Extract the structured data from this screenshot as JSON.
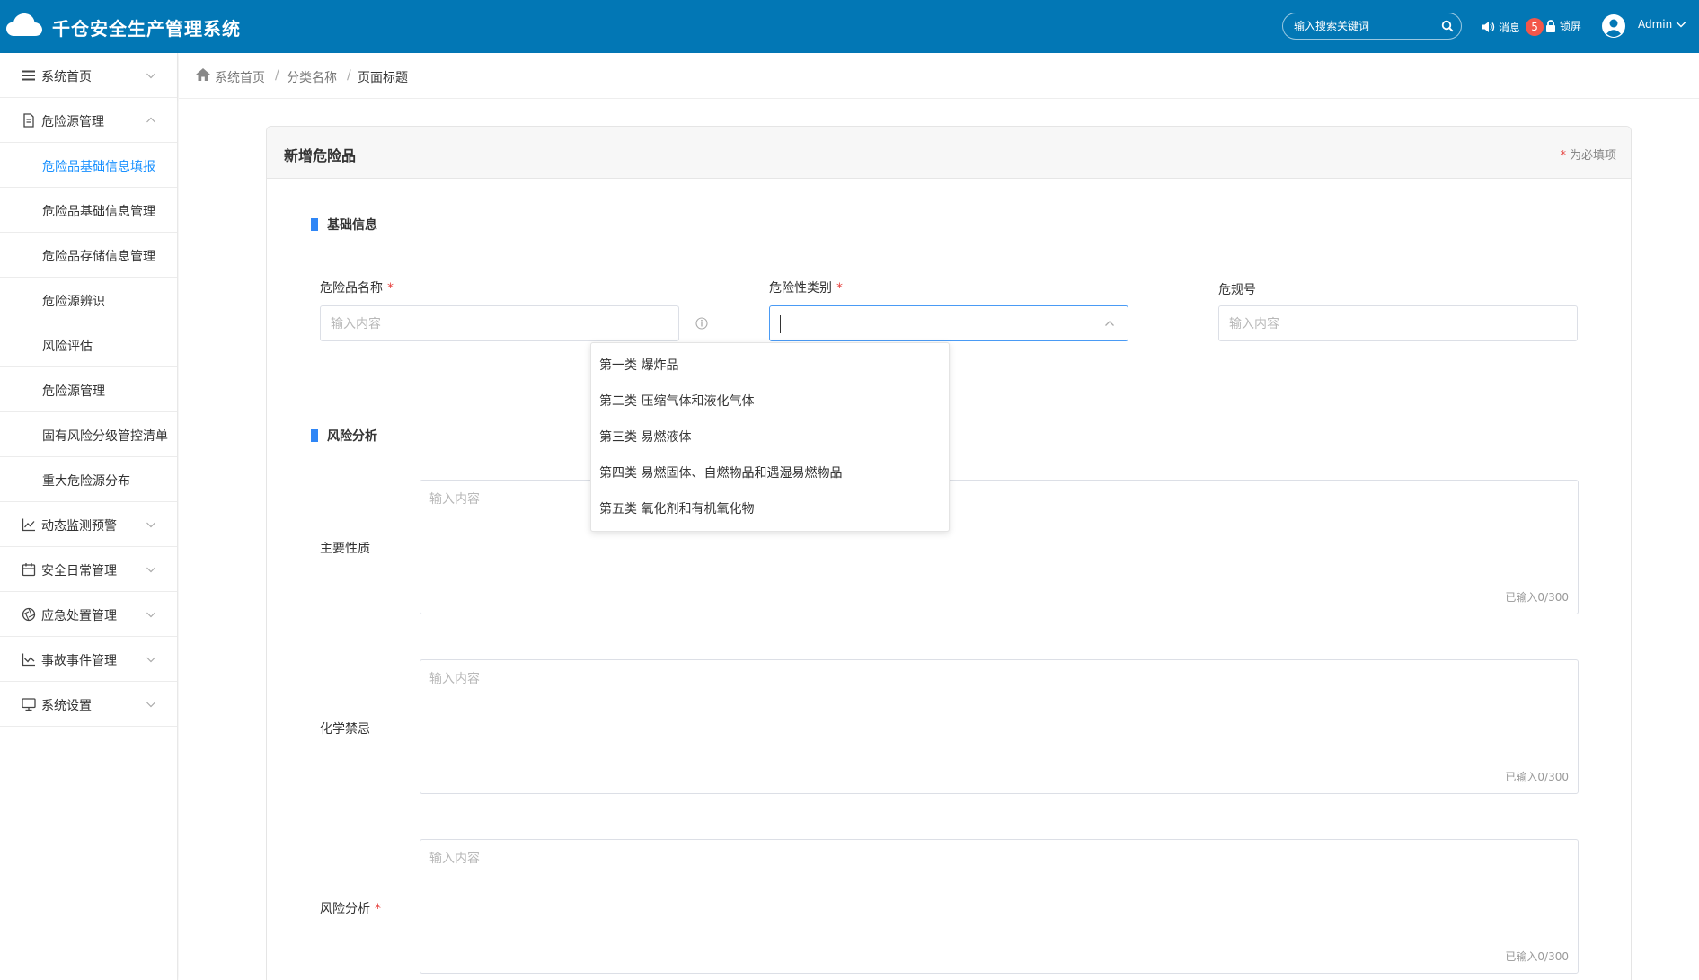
{
  "header": {
    "app_title": "千仓安全生产管理系统",
    "search_placeholder": "输入搜索关键词",
    "messages_label": "消息",
    "messages_count": "5",
    "lock_label": "锁屏",
    "user_name": "Admin"
  },
  "sidebar": {
    "items": [
      {
        "label": "系统首页"
      },
      {
        "label": "危险源管理"
      },
      {
        "label": "动态监测预警"
      },
      {
        "label": "安全日常管理"
      },
      {
        "label": "应急处置管理"
      },
      {
        "label": "事故事件管理"
      },
      {
        "label": "系统设置"
      }
    ],
    "sub_items": [
      {
        "label": "危险品基础信息填报",
        "active": true
      },
      {
        "label": "危险品基础信息管理"
      },
      {
        "label": "危险品存储信息管理"
      },
      {
        "label": "危险源辨识"
      },
      {
        "label": "风险评估"
      },
      {
        "label": "危险源管理"
      },
      {
        "label": "固有风险分级管控清单"
      },
      {
        "label": "重大危险源分布"
      }
    ]
  },
  "breadcrumb": {
    "items": [
      "系统首页",
      "分类名称",
      "页面标题"
    ],
    "separator": "/"
  },
  "form": {
    "title": "新增危险品",
    "required_note_star": "*",
    "required_note": "为必填项",
    "section_basic": "基础信息",
    "section_risk": "风险分析",
    "fields": {
      "name_label": "危险品名称",
      "name_placeholder": "输入内容",
      "category_label": "危险性类别",
      "code_label": "危规号",
      "code_placeholder": "输入内容",
      "main_nature_label": "主要性质",
      "main_nature_placeholder": "输入内容",
      "chem_taboo_label": "化学禁忌",
      "chem_taboo_placeholder": "输入内容",
      "risk_analysis_label": "风险分析",
      "risk_analysis_placeholder": "输入内容"
    },
    "required_star": "*",
    "counter_text": "已输入0/300"
  },
  "category_options": [
    "第一类 爆炸品",
    "第二类 压缩气体和液化气体",
    "第三类 易燃液体",
    "第四类 易燃固体、自燃物品和遇湿易燃物品",
    "第五类 氧化剂和有机氧化物"
  ],
  "colors": {
    "header_bg": "#0277b5",
    "accent": "#1890ff",
    "required": "#e64340",
    "badge": "#f3564a",
    "section_bar": "#2f86f6"
  }
}
